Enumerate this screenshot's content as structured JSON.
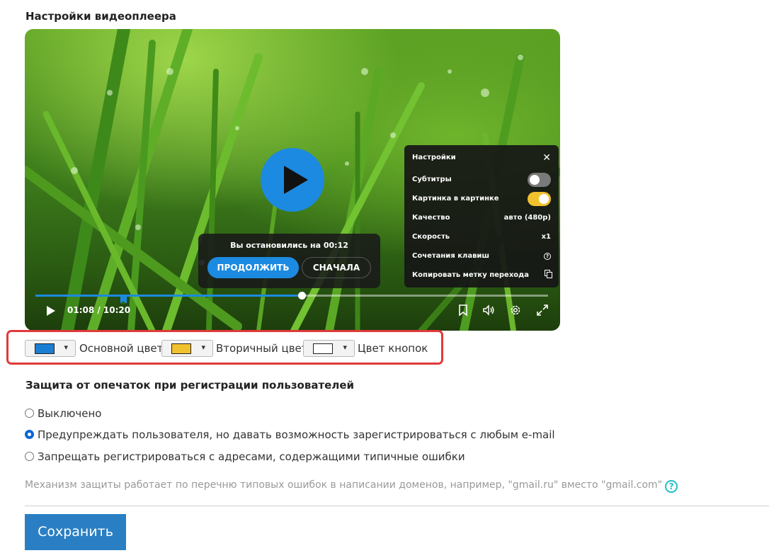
{
  "player_section": {
    "title": "Настройки видеоплеера",
    "resume": {
      "message": "Вы остановились на 00:12",
      "continue_label": "ПРОДОЛЖИТЬ",
      "restart_label": "СНАЧАЛА"
    },
    "settings_panel": {
      "title": "Настройки",
      "close_icon": "close-icon",
      "subtitles_label": "Субтитры",
      "subtitles_enabled": false,
      "pip_label": "Картинка в картинке",
      "pip_enabled": true,
      "quality_label": "Качество",
      "quality_value": "авто (480p)",
      "speed_label": "Скорость",
      "speed_value": "x1",
      "hotkeys_label": "Сочетания клавиш",
      "copy_label": "Копировать метку перехода"
    },
    "controls": {
      "time": "01:08 / 10:20",
      "progress_fraction": 0.52,
      "buffered_fraction": 0.19,
      "accent_color": "#1c8ae0"
    }
  },
  "color_settings": {
    "primary": {
      "color": "#1a7fd4",
      "label": "Основной цвет"
    },
    "secondary": {
      "color": "#f2c12e",
      "label": "Вторичный цвет"
    },
    "buttons": {
      "color": "#ffffff",
      "label": "Цвет кнопок"
    },
    "arrow": "▾"
  },
  "protection": {
    "title": "Защита от опечаток при регистрации пользователей",
    "options": [
      {
        "label": "Выключено",
        "checked": false
      },
      {
        "label": "Предупреждать пользователя, но давать возможность зарегистрироваться с любым e-mail",
        "checked": true
      },
      {
        "label": "Запрещать регистрироваться с адресами, содержащими типичные ошибки",
        "checked": false
      }
    ],
    "hint": "Механизм защиты работает по перечню типовых ошибок в написании доменов, например, \"gmail.ru\" вместо \"gmail.com\"",
    "hint_icon": "?"
  },
  "save_label": "Сохранить"
}
